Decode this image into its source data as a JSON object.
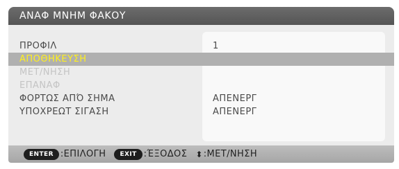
{
  "title": "ΑΝΑΦ ΜΝΗΜ ΦΑΚΟΥ",
  "menu": {
    "profile_label": "ΠΡΟΦΙΛ",
    "profile_value": "1",
    "store_label": "ΑΠΟΘΗΚΕΥΣΗ",
    "move_label": "ΜΕΤ/ΝΗΣΗ",
    "reset_label": "ΕΠΑΝΑΦ",
    "load_by_signal_label": "ΦΟΡΤΩΣ ΑΠΌ ΣΗΜΑ",
    "load_by_signal_value": "ΑΠΕΝΕΡΓ",
    "forced_mute_label": "ΥΠΟΧΡΕΩΤ ΣΙΓΑΣΗ",
    "forced_mute_value": "ΑΠΕΝΕΡΓ"
  },
  "footer": {
    "enter_key": "ENTER",
    "enter_hint": ":ΕΠΙΛΟΓΗ",
    "exit_key": "EXIT",
    "exit_hint": ":ΈΞΟΔΟΣ",
    "arrows_glyph": "⬍",
    "move_hint": ":ΜΕΤ/ΝΗΣΗ"
  },
  "colors": {
    "selected_text": "#ffef1e",
    "selected_row": "#b0b0b0",
    "disabled_text": "#c4c4c4"
  }
}
